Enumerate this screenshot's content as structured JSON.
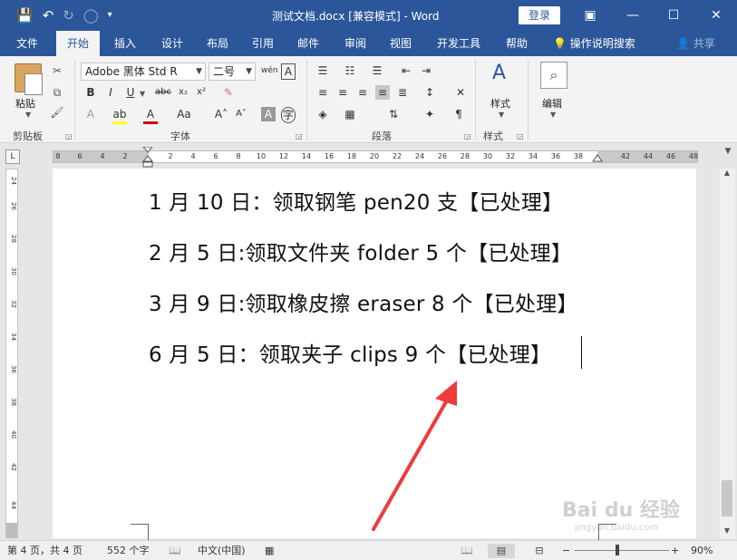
{
  "window": {
    "title": "测试文档.docx [兼容模式] - Word",
    "login_label": "登录",
    "icons": [
      "save-icon",
      "undo-icon",
      "redo-icon",
      "repeat-icon",
      "customize-qat-icon",
      "ribbon-display-icon",
      "minimize-icon",
      "maximize-icon",
      "close-icon"
    ]
  },
  "tabs": [
    {
      "label": "文件"
    },
    {
      "label": "开始",
      "active": true
    },
    {
      "label": "插入"
    },
    {
      "label": "设计"
    },
    {
      "label": "布局"
    },
    {
      "label": "引用"
    },
    {
      "label": "邮件"
    },
    {
      "label": "审阅"
    },
    {
      "label": "视图"
    },
    {
      "label": "开发工具"
    },
    {
      "label": "帮助"
    }
  ],
  "tell_me": "操作说明搜索",
  "share": "共享",
  "ribbon": {
    "clipboard": {
      "label": "剪贴板",
      "paste_label": "粘贴"
    },
    "font": {
      "label": "字体",
      "font_name": "Adobe 黑体 Std R",
      "font_size": "二号"
    },
    "paragraph": {
      "label": "段落"
    },
    "styles": {
      "label": "样式",
      "styles_label": "样式"
    },
    "editing": {
      "label": "编辑",
      "editing_label": "编辑"
    }
  },
  "ruler": {
    "corner": "L",
    "h_numbers": [
      "8",
      "6",
      "4",
      "2",
      "2",
      "4",
      "6",
      "8",
      "10",
      "12",
      "14",
      "16",
      "18",
      "20",
      "22",
      "24",
      "26",
      "28",
      "30",
      "32",
      "34",
      "36",
      "38",
      "42",
      "44",
      "46",
      "48"
    ],
    "v_numbers": [
      "24",
      "26",
      "28",
      "30",
      "32",
      "34",
      "36",
      "38",
      "40",
      "42",
      "44"
    ]
  },
  "document": {
    "lines": [
      "1 月 10 日：领取钢笔 pen20 支【已处理】",
      "2 月 5 日:领取文件夹 folder 5 个【已处理】",
      "3 月 9 日:领取橡皮擦 eraser 8 个【已处理】",
      "6 月 5 日：领取夹子 clips 9 个【已处理】"
    ]
  },
  "annotation": {
    "arrow_color": "#ee3b3b"
  },
  "watermark": {
    "main": "Bai du 经验",
    "sub": "jingyan.baidu.com"
  },
  "status": {
    "page": "第 4 页，共 4 页",
    "words": "552 个字",
    "language": "中文(中国)",
    "zoom": "90%",
    "zoom_level": 0.45
  },
  "colors": {
    "brand": "#2b579a",
    "ribbon_bg": "#f3f3f3"
  }
}
